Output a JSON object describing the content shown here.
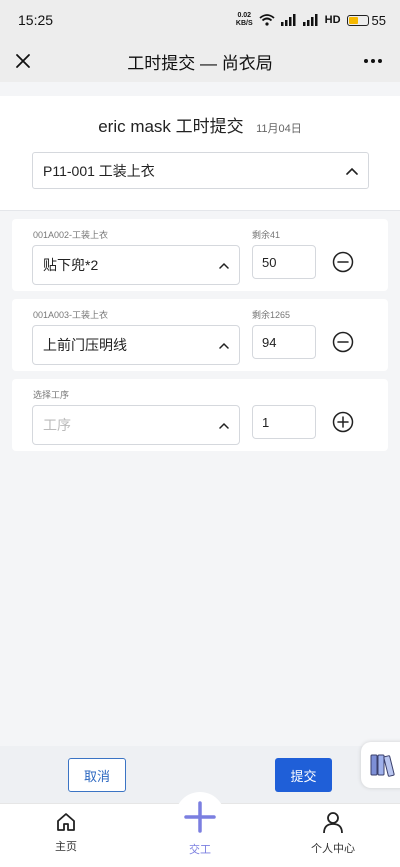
{
  "status_bar": {
    "time": "15:25",
    "net_speed_value": "0.02",
    "net_speed_unit": "KB/S",
    "hd_label": "HD",
    "battery": "55"
  },
  "title_bar": {
    "title": "工时提交 — 尚衣局"
  },
  "header": {
    "name": "eric mask 工时提交",
    "date": "11月04日",
    "order_value": "P11-001 工装上衣"
  },
  "processes": [
    {
      "label": "001A002-工装上衣",
      "remain": "剩余41",
      "process": "贴下兜*2",
      "quantity": "50",
      "action_icon": "minus-circle-icon"
    },
    {
      "label": "001A003-工装上衣",
      "remain": "剩余1265",
      "process": "上前门压明线",
      "quantity": "94",
      "action_icon": "minus-circle-icon"
    },
    {
      "label": "选择工序",
      "remain": "",
      "process_placeholder": "工序",
      "quantity": "1",
      "action_icon": "plus-circle-icon"
    }
  ],
  "actions": {
    "cancel_label": "取消",
    "submit_label": "提交"
  },
  "tab_bar": {
    "home_label": "主页",
    "center_label": "交工",
    "profile_label": "个人中心"
  },
  "colors": {
    "primary": "#1f5fd8",
    "accent": "#7b7fe0",
    "background": "#f4f5f7"
  }
}
